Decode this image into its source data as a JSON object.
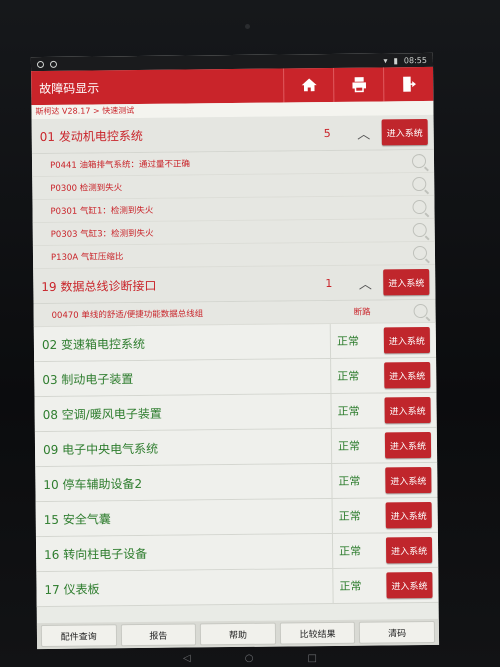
{
  "status_bar": {
    "time": "08:55"
  },
  "header": {
    "title": "故障码显示",
    "buttons": [
      {
        "name": "home-button",
        "icon": "home-icon"
      },
      {
        "name": "print-button",
        "icon": "print-icon"
      },
      {
        "name": "exit-button",
        "icon": "exit-icon"
      }
    ]
  },
  "breadcrumb": "斯柯达 V28.17 > 快速测试",
  "enter_label": "进入系统",
  "systems": [
    {
      "name": "01 发动机电控系统",
      "status": "5",
      "fault": true,
      "dtcs": [
        {
          "text": "P0441 油箱排气系统：通过量不正确",
          "status": ""
        },
        {
          "text": "P0300 检测到失火",
          "status": ""
        },
        {
          "text": "P0301 气缸1：检测到失火",
          "status": ""
        },
        {
          "text": "P0303 气缸3：检测到失火",
          "status": ""
        },
        {
          "text": "P130A 气缸压缩比",
          "status": ""
        }
      ]
    },
    {
      "name": "19 数据总线诊断接口",
      "status": "1",
      "fault": true,
      "dtcs": [
        {
          "text": "00470 单线的舒适/便捷功能数据总线组",
          "status": "断路"
        }
      ]
    },
    {
      "name": "02 变速箱电控系统",
      "status": "正常",
      "fault": false
    },
    {
      "name": "03 制动电子装置",
      "status": "正常",
      "fault": false
    },
    {
      "name": "08 空调/暖风电子装置",
      "status": "正常",
      "fault": false
    },
    {
      "name": "09 电子中央电气系统",
      "status": "正常",
      "fault": false
    },
    {
      "name": "10 停车辅助设备2",
      "status": "正常",
      "fault": false
    },
    {
      "name": "15 安全气囊",
      "status": "正常",
      "fault": false
    },
    {
      "name": "16 转向柱电子设备",
      "status": "正常",
      "fault": false
    },
    {
      "name": "17 仪表板",
      "status": "正常",
      "fault": false
    }
  ],
  "toolbar": {
    "parts": "配件查询",
    "report": "报告",
    "help": "帮助",
    "compare": "比较结果",
    "clear": "清码"
  },
  "colors": {
    "brand_red": "#c9242a",
    "ok_green": "#2e7d2e"
  }
}
